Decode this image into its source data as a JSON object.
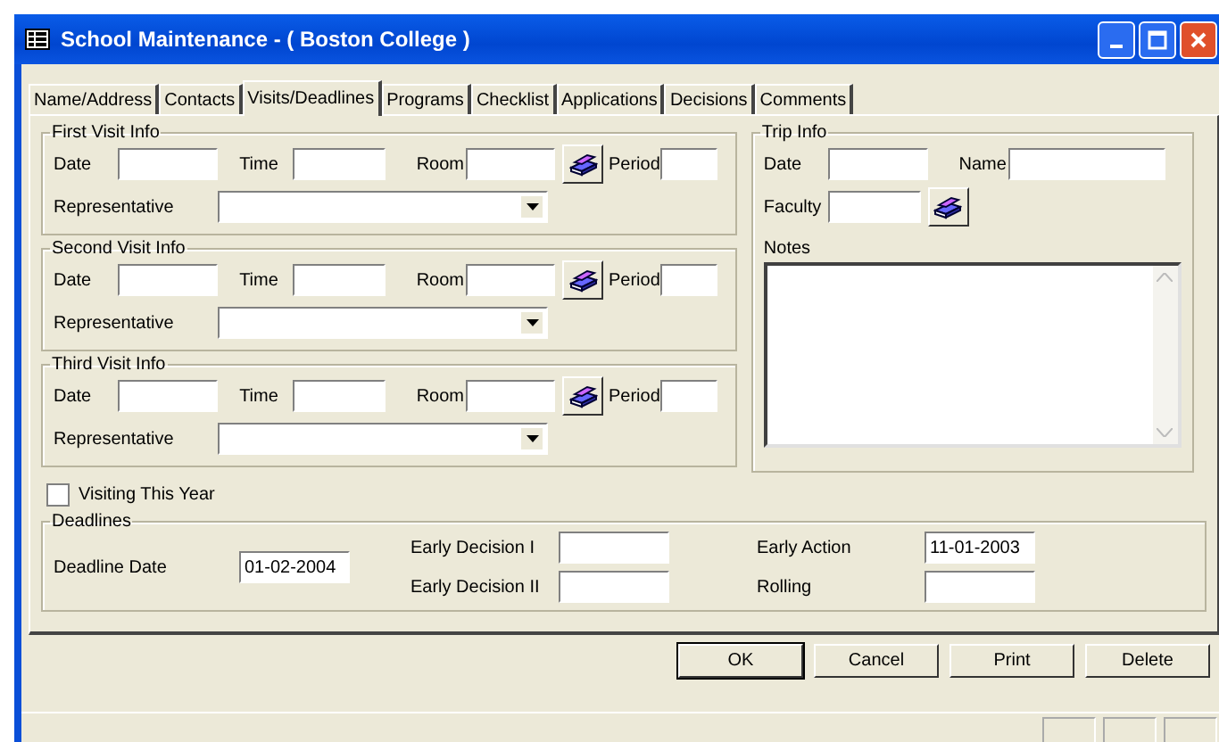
{
  "window": {
    "title": "School Maintenance - ( Boston College )"
  },
  "tabs": [
    {
      "label": "Name/Address",
      "selected": false
    },
    {
      "label": "Contacts",
      "selected": false
    },
    {
      "label": "Visits/Deadlines",
      "selected": true
    },
    {
      "label": "Programs",
      "selected": false
    },
    {
      "label": "Checklist",
      "selected": false
    },
    {
      "label": "Applications",
      "selected": false
    },
    {
      "label": "Decisions",
      "selected": false
    },
    {
      "label": "Comments",
      "selected": false
    }
  ],
  "visits": [
    {
      "title": "First Visit Info",
      "date_label": "Date",
      "time_label": "Time",
      "room_label": "Room",
      "period_label": "Period",
      "representative_label": "Representative"
    },
    {
      "title": "Second Visit Info",
      "date_label": "Date",
      "time_label": "Time",
      "room_label": "Room",
      "period_label": "Period",
      "representative_label": "Representative"
    },
    {
      "title": "Third Visit Info",
      "date_label": "Date",
      "time_label": "Time",
      "room_label": "Room",
      "period_label": "Period",
      "representative_label": "Representative"
    }
  ],
  "trip_info": {
    "title": "Trip Info",
    "date_label": "Date",
    "name_label": "Name",
    "faculty_label": "Faculty",
    "notes_label": "Notes"
  },
  "visiting_this_year": {
    "label": "Visiting This Year",
    "checked": false
  },
  "deadlines": {
    "title": "Deadlines",
    "columns": [
      [
        {
          "label": "Deadline Date",
          "value": "01-02-2004"
        }
      ],
      [
        {
          "label": "Early Decision I"
        },
        {
          "label": "Early Decision II"
        }
      ],
      [
        {
          "label": "Early Action",
          "value": "11-01-2003"
        },
        {
          "label": "Rolling"
        }
      ]
    ]
  },
  "buttons": [
    "OK",
    "Cancel",
    "Print",
    "Delete"
  ]
}
